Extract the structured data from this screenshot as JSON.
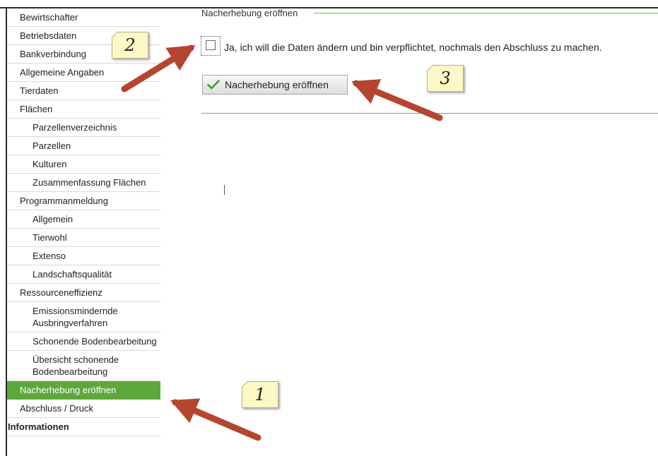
{
  "sidebar": {
    "items": [
      {
        "label": "Bewirtschafter",
        "level": 0
      },
      {
        "label": "Betriebsdaten",
        "level": 0
      },
      {
        "label": "Bankverbindung",
        "level": 0
      },
      {
        "label": "Allgemeine Angaben",
        "level": 0
      },
      {
        "label": "Tierdaten",
        "level": 0
      },
      {
        "label": "Flächen",
        "level": 0
      },
      {
        "label": "Parzellenverzeichnis",
        "level": 1
      },
      {
        "label": "Parzellen",
        "level": 1
      },
      {
        "label": "Kulturen",
        "level": 1
      },
      {
        "label": "Zusammenfassung Flächen",
        "level": 1
      },
      {
        "label": "Programmanmeldung",
        "level": 0
      },
      {
        "label": "Allgemein",
        "level": 1
      },
      {
        "label": "Tierwohl",
        "level": 1
      },
      {
        "label": "Extenso",
        "level": 1
      },
      {
        "label": "Landschaftsqualität",
        "level": 1
      },
      {
        "label": "Ressourceneffizienz",
        "level": 0
      },
      {
        "label": "Emissionsmindernde Ausbringverfahren",
        "level": 1
      },
      {
        "label": "Schonende Bodenbearbeitung",
        "level": 1
      },
      {
        "label": "Übersicht schonende Bodenbearbeitung",
        "level": 1
      },
      {
        "label": "Nacherhebung eröffnen",
        "level": 0,
        "active": true
      },
      {
        "label": "Abschluss / Druck",
        "level": 0
      },
      {
        "label": "Informationen",
        "level": 0,
        "heading": true
      }
    ]
  },
  "main": {
    "section_title": "Nacherhebung eröffnen",
    "checkbox_label": "Ja, ich will die Daten ändern und bin verpflichtet, nochmals den Abschluss zu machen.",
    "checkbox_checked": false,
    "button_label": "Nacherhebung eröffnen",
    "button_icon": "checkmark-icon"
  },
  "callouts": {
    "note1": "1",
    "note2": "2",
    "note3": "3"
  },
  "colors": {
    "accent_green": "#5ea73b",
    "rule_green": "#6cbf45",
    "arrow_red": "#b5452f",
    "note_yellow": "#fdf8c6"
  }
}
